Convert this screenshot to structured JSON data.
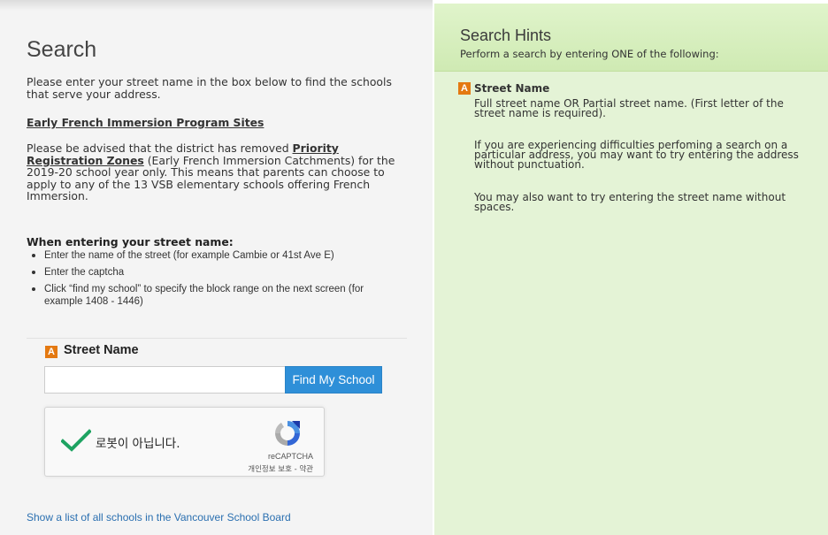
{
  "search": {
    "title": "Search",
    "intro": "Please enter your street name in the box below to find the schools that serve your address.",
    "french_immersion_link": "Early French Immersion Program Sites",
    "notice_before": "Please be advised that the district has removed ",
    "notice_link": "Priority Registration Zones",
    "notice_after": " (Early French Immersion Catchments) for the 2019-20 school year only. This means that parents can choose to apply to any of the 13 VSB elementary schools offering French Immersion.",
    "instructions_heading": "When entering your street name:",
    "instructions": [
      "Enter the name of the street (for example Cambie or 41st Ave E)",
      "Enter the captcha",
      "Click “find my school” to specify the block range on the next screen (for example 1408 - 1446)"
    ],
    "field_badge": "A",
    "field_label": "Street Name",
    "street_value": "",
    "find_button": "Find My School",
    "captcha_label": "로봇이 아닙니다.",
    "captcha_brand": "reCAPTCHA",
    "captcha_links": "개인정보 보호 - 약관",
    "all_schools_link": "Show a list of all schools in the Vancouver School Board"
  },
  "hints": {
    "title": "Search Hints",
    "subtitle": "Perform a search by entering ONE of the following:",
    "badge": "A",
    "heading": "Street Name",
    "line1": "Full street name OR Partial street name. (First letter of the street name is required).",
    "line2": "If you are experiencing difficulties perfoming a search on a particular address, you may want to try entering the address without punctuation.",
    "line3": "You may also want to try entering the street name without spaces."
  },
  "colors": {
    "accent_button": "#2e8fd8",
    "badge_orange": "#e47911",
    "hints_background": "#e4f3d6",
    "check_green": "#1ea362",
    "link_blue": "#2a6fb0"
  },
  "icons": {
    "captcha_check": "check-icon",
    "captcha_logo": "recaptcha-logo-icon"
  }
}
